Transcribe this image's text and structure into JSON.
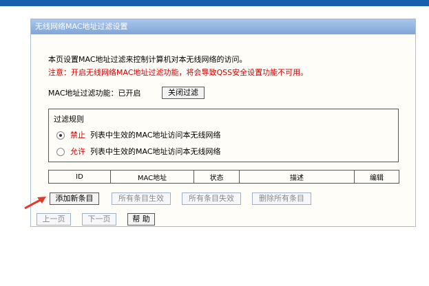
{
  "panel": {
    "title": "无线网络MAC地址过滤设置",
    "description": "本页设置MAC地址过滤来控制计算机对本无线网络的访问。",
    "warning": "注意：开启无线网络MAC地址过滤功能，将会导致QSS安全设置功能不可用。"
  },
  "filter": {
    "status_label": "MAC地址过滤功能：已开启",
    "close_button": "关闭过滤"
  },
  "rules": {
    "title": "过滤规则",
    "deny_keyword": "禁止",
    "deny_text": "列表中生效的MAC地址访问本无线网络",
    "allow_keyword": "允许",
    "allow_text": "列表中生效的MAC地址访问本无线网络",
    "selected": "deny"
  },
  "table": {
    "headers": [
      "ID",
      "MAC地址",
      "状态",
      "描述",
      "编辑"
    ]
  },
  "actions": {
    "add": "添加新条目",
    "enable_all": "所有条目生效",
    "disable_all": "所有条目失效",
    "delete_all": "删除所有条目"
  },
  "nav": {
    "prev": "上一页",
    "next": "下一页",
    "help": "帮 助"
  },
  "colors": {
    "title_bar": "#7ea6d8",
    "warning_red": "#cc0000",
    "top_bar": "#1a5fab",
    "arrow": "#e03b2a"
  }
}
